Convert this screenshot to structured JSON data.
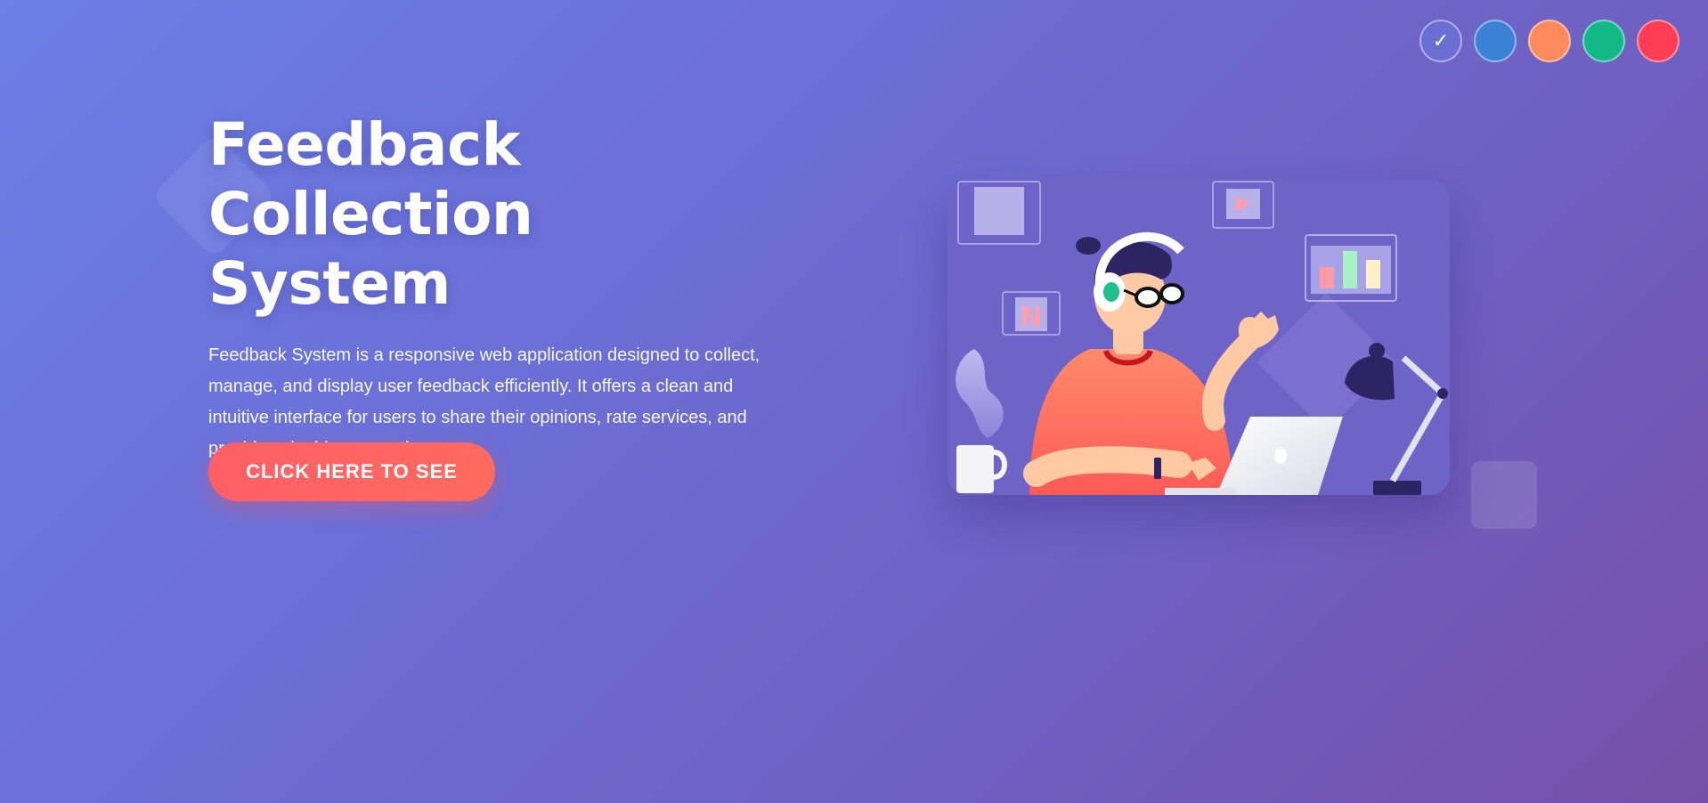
{
  "theme_switcher": {
    "swatches": [
      {
        "name": "purple",
        "color": "#6a6fd4",
        "selected": true,
        "mark": "✓"
      },
      {
        "name": "blue",
        "color": "#3b82d6",
        "selected": false,
        "mark": ""
      },
      {
        "name": "orange",
        "color": "#ff8a5b",
        "selected": false,
        "mark": ""
      },
      {
        "name": "green",
        "color": "#12b886",
        "selected": false,
        "mark": ""
      },
      {
        "name": "red",
        "color": "#ff3d55",
        "selected": false,
        "mark": ""
      }
    ]
  },
  "hero": {
    "title_line1": "Feedback Collection",
    "title_line2": "System",
    "description": "Feedback System is a responsive web application designed to collect, manage, and display user feedback efficiently. It offers a clean and intuitive interface for users to share their opinions, rate services, and provide valuable suggestions.",
    "cta_label": "CLICK HERE TO SEE"
  },
  "illustration": {
    "app_tile_letter": "N",
    "icons": [
      "image-frame-icon",
      "play-icon",
      "bar-chart-icon",
      "n-app-icon",
      "desk-lamp-icon",
      "coffee-mug-icon",
      "laptop-icon",
      "headphones-icon"
    ]
  },
  "colors": {
    "accent": "#ff5f66",
    "background_start": "#6b7fe6",
    "background_end": "#7650a8"
  }
}
